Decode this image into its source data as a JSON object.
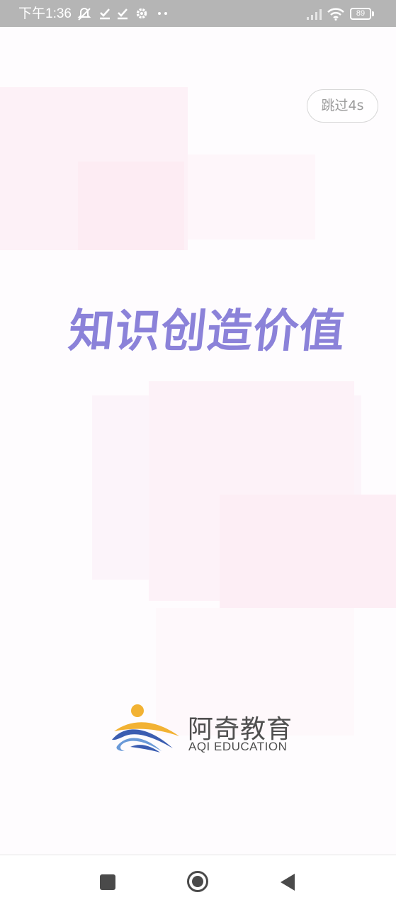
{
  "status_bar": {
    "time": "下午1:36",
    "battery": "89",
    "icons": [
      "mute-bell-icon",
      "check-icon",
      "check-icon",
      "gear-icon",
      "more-dots-icon",
      "signal-icon",
      "wifi-icon",
      "battery-icon"
    ]
  },
  "splash": {
    "skip_label": "跳过4s",
    "slogan": "知识创造价值",
    "slogan_color": "#8b82d9",
    "logo": {
      "name_cn": "阿奇教育",
      "name_en": "AQI EDUCATION",
      "colors": [
        "#f2b233",
        "#3b5db1",
        "#6a9ad8"
      ]
    }
  },
  "nav_bar": {
    "buttons": [
      "recents-icon",
      "home-icon",
      "back-icon"
    ]
  }
}
